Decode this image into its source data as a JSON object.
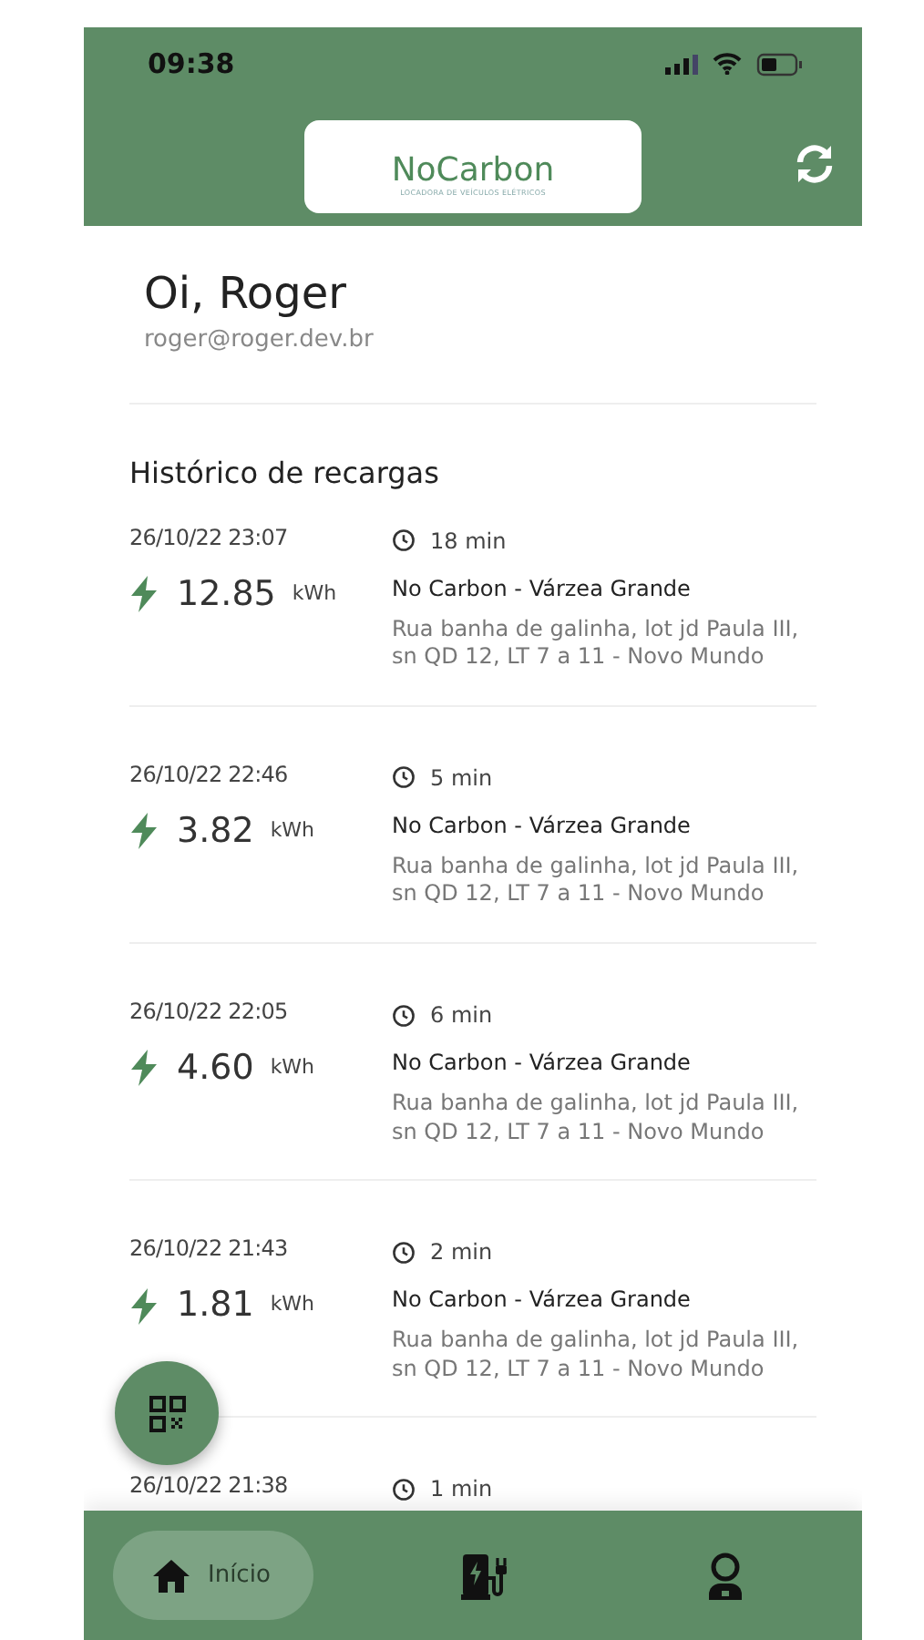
{
  "status_bar": {
    "time": "09:38"
  },
  "header": {
    "logo": {
      "name": "NoCarbon",
      "tagline": "LOCADORA DE VEÍCULOS ELÉTRICOS"
    }
  },
  "user": {
    "greeting": "Oi, Roger",
    "email": "roger@roger.dev.br"
  },
  "history": {
    "title": "Histórico de recargas",
    "items": [
      {
        "date": "26/10/22 23:07",
        "duration": "18 min",
        "energy": "12.85",
        "unit": "kWh",
        "station": "No Carbon - Várzea Grande",
        "address": "Rua banha de galinha, lot jd Paula III, sn QD 12, LT 7 a 11 - Novo Mundo"
      },
      {
        "date": "26/10/22 22:46",
        "duration": "5 min",
        "energy": "3.82",
        "unit": "kWh",
        "station": "No Carbon - Várzea Grande",
        "address": "Rua banha de galinha, lot jd Paula III, sn QD 12, LT 7 a 11 - Novo Mundo"
      },
      {
        "date": "26/10/22 22:05",
        "duration": "6 min",
        "energy": "4.60",
        "unit": "kWh",
        "station": "No Carbon - Várzea Grande",
        "address": "Rua banha de galinha, lot jd Paula III, sn QD 12, LT 7 a 11 - Novo Mundo"
      },
      {
        "date": "26/10/22 21:43",
        "duration": "2 min",
        "energy": "1.81",
        "unit": "kWh",
        "station": "No Carbon - Várzea Grande",
        "address": "Rua banha de galinha, lot jd Paula III, sn QD 12, LT 7 a 11 - Novo Mundo"
      },
      {
        "date": "26/10/22 21:38",
        "duration": "1 min"
      }
    ]
  },
  "nav": [
    {
      "kind": "home",
      "label": "Início",
      "selected": true
    },
    {
      "kind": "charger",
      "selected": false
    },
    {
      "kind": "profile",
      "selected": false
    }
  ]
}
